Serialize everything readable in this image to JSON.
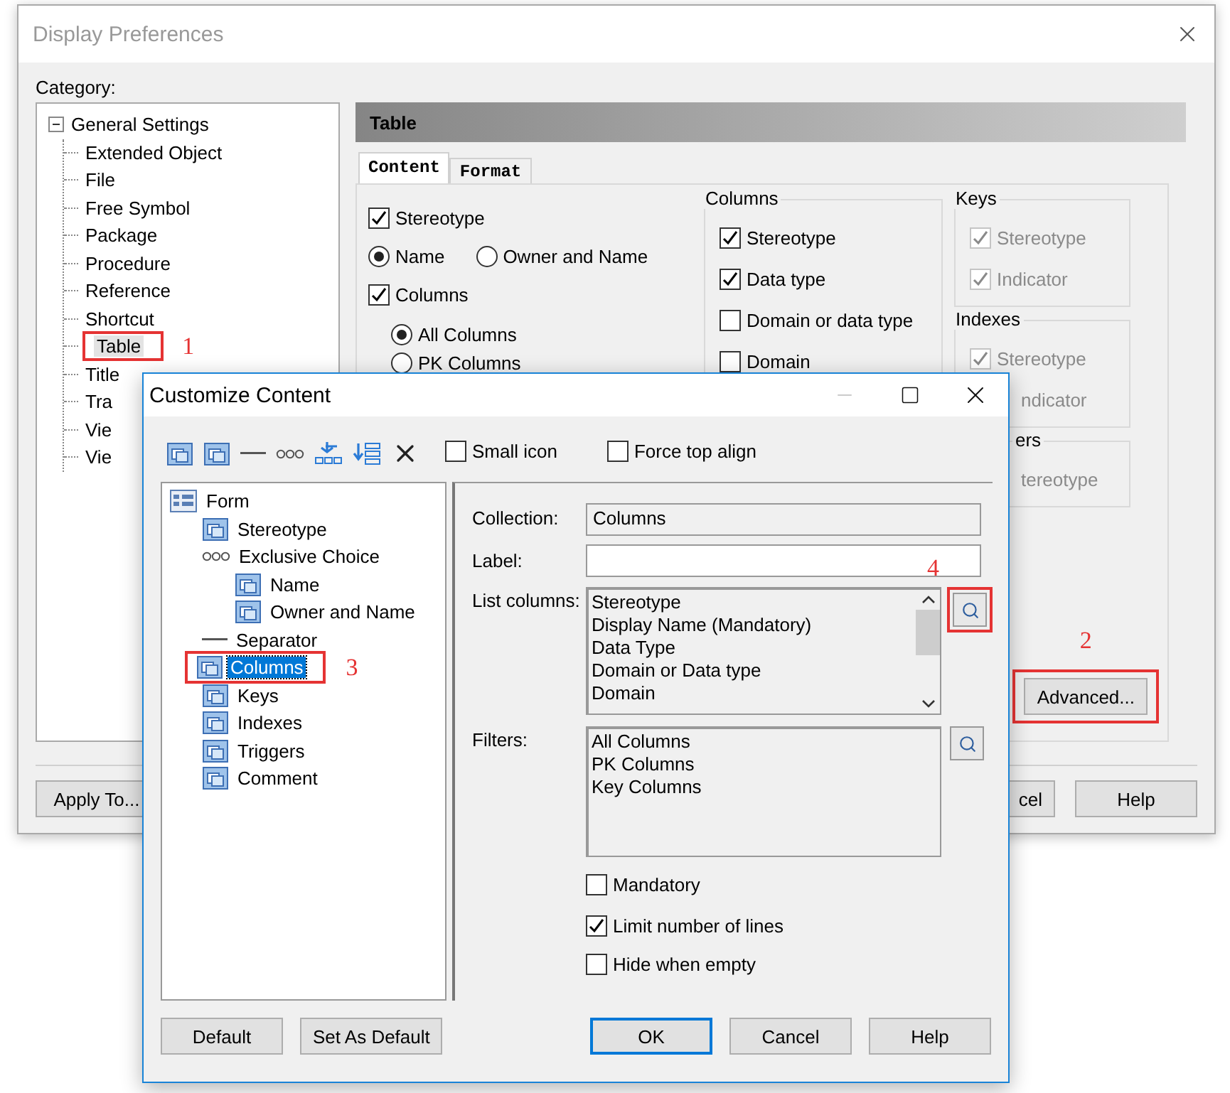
{
  "background_window": {
    "title": "Display Preferences",
    "category_label": "Category:",
    "tree": [
      {
        "label": "General Settings",
        "expanded": true,
        "children": [
          {
            "label": "Extended Object",
            "selected": false
          },
          {
            "label": "File",
            "selected": false
          },
          {
            "label": "Free Symbol",
            "selected": false
          },
          {
            "label": "Package",
            "selected": false
          },
          {
            "label": "Procedure",
            "selected": false
          },
          {
            "label": "Reference",
            "selected": false
          },
          {
            "label": "Shortcut",
            "selected": false
          },
          {
            "label": "Table",
            "selected": true,
            "callout": "1"
          },
          {
            "label": "Title",
            "selected": false
          },
          {
            "label": "Tra",
            "selected": false
          },
          {
            "label": "Vie",
            "selected": false
          },
          {
            "label": "Vie",
            "selected": false
          }
        ]
      }
    ],
    "panel_title": "Table",
    "tabs": [
      {
        "label": "Content",
        "selected": true
      },
      {
        "label": "Format",
        "selected": false
      }
    ],
    "stereotype": {
      "label": "Stereotype",
      "checked": true
    },
    "name_options": [
      {
        "label": "Name",
        "selected": true
      },
      {
        "label": "Owner and Name",
        "selected": false
      }
    ],
    "columns": {
      "label": "Columns",
      "checked": true
    },
    "column_options": [
      {
        "label": "All Columns",
        "selected": true
      },
      {
        "label": "PK Columns",
        "selected": false
      }
    ],
    "groups": [
      {
        "title": "Columns",
        "kind": "box",
        "disabled": false,
        "items": [
          {
            "kind": "checkbox",
            "label": "Stereotype",
            "checked": true
          },
          {
            "kind": "checkbox",
            "label": "Data type",
            "checked": true
          },
          {
            "kind": "checkbox",
            "label": "Domain or data type",
            "checked": false
          },
          {
            "kind": "checkbox",
            "label": "Domain",
            "checked": false
          }
        ]
      },
      {
        "title": "Keys",
        "kind": "box",
        "disabled": true,
        "items": [
          {
            "kind": "checkbox",
            "label": "Stereotype",
            "checked": true
          },
          {
            "kind": "checkbox",
            "label": "Indicator",
            "checked": true
          }
        ]
      },
      {
        "title": "Indexes",
        "kind": "box",
        "disabled": true,
        "items": [
          {
            "kind": "checkbox",
            "label": "Stereotype",
            "checked": true
          },
          {
            "kind": "text",
            "label": "ndicator"
          }
        ]
      },
      {
        "title": "ers",
        "kind": "cut",
        "disabled": true,
        "items": [
          {
            "kind": "text",
            "label": "tereotype"
          }
        ]
      }
    ],
    "advanced_button": {
      "label": "Advanced...",
      "callout": "2"
    },
    "buttons": [
      {
        "label": "Apply To...",
        "kind": "left"
      },
      {
        "label": "cel",
        "kind": "right"
      },
      {
        "label": "Help",
        "kind": "right"
      }
    ]
  },
  "dialog": {
    "title": "Customize Content",
    "toolbar": [
      {
        "kind": "stack"
      },
      {
        "kind": "stack"
      },
      {
        "kind": "line"
      },
      {
        "kind": "dots"
      },
      {
        "kind": "add"
      },
      {
        "kind": "list"
      },
      {
        "kind": "delete"
      }
    ],
    "toolbar_options": [
      {
        "label": "Small icon",
        "checked": false
      },
      {
        "label": "Force top align",
        "checked": false
      }
    ],
    "tree": [
      {
        "label": "Form",
        "kind": "form",
        "selected": false,
        "children": [
          {
            "label": "Stereotype",
            "kind": "stack",
            "selected": false
          },
          {
            "label": "Exclusive Choice",
            "kind": "dots",
            "selected": false,
            "children": [
              {
                "label": "Name",
                "kind": "stack",
                "selected": false
              },
              {
                "label": "Owner and Name",
                "kind": "stack",
                "selected": false
              }
            ]
          },
          {
            "label": "Separator",
            "kind": "line",
            "selected": false
          },
          {
            "label": "Columns",
            "kind": "stack",
            "selected": true,
            "callout": "3"
          },
          {
            "label": "Keys",
            "kind": "stack",
            "selected": false
          },
          {
            "label": "Indexes",
            "kind": "stack",
            "selected": false
          },
          {
            "label": "Triggers",
            "kind": "stack",
            "selected": false
          },
          {
            "label": "Comment",
            "kind": "stack",
            "selected": false
          }
        ]
      }
    ],
    "collection": {
      "label": "Collection:",
      "value": "Columns"
    },
    "label_field": {
      "label": "Label:"
    },
    "list_columns": {
      "label": "List columns:",
      "items": [
        "Stereotype",
        "Display Name (Mandatory)",
        "Data Type",
        "Domain or Data type",
        "Domain"
      ],
      "callout": "4"
    },
    "filters": {
      "label": "Filters:",
      "items": [
        "All Columns",
        "PK Columns",
        "Key Columns"
      ]
    },
    "options": [
      {
        "label": "Mandatory",
        "checked": false
      },
      {
        "label": "Limit number of lines",
        "checked": true
      },
      {
        "label": "Hide when empty",
        "checked": false
      }
    ],
    "buttons": [
      {
        "label": "Default",
        "kind": "left",
        "default": false
      },
      {
        "label": "Set As Default",
        "kind": "left",
        "default": false
      },
      {
        "label": "OK",
        "kind": "right",
        "default": true
      },
      {
        "label": "Cancel",
        "kind": "right",
        "default": false
      },
      {
        "label": "Help",
        "kind": "right",
        "default": false
      }
    ]
  }
}
